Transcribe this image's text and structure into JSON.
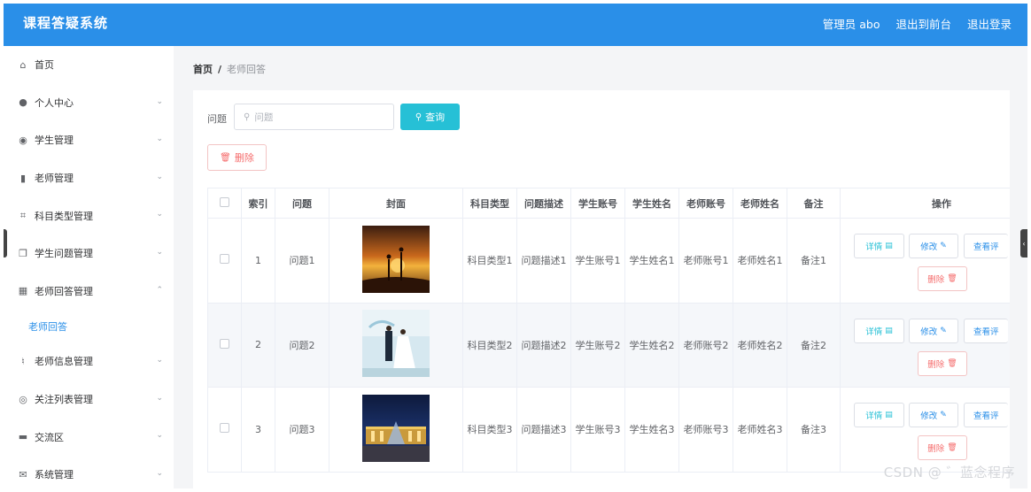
{
  "header": {
    "title": "课程答疑系统",
    "admin": "管理员 abo",
    "back_to_front": "退出到前台",
    "logout": "退出登录",
    "color": "#2a8fe8"
  },
  "sidebar": {
    "items": [
      {
        "label": "首页",
        "icon": "home-icon",
        "glyph": "⌂"
      },
      {
        "label": "个人中心",
        "icon": "user-icon",
        "glyph": "●"
      },
      {
        "label": "学生管理",
        "icon": "location-icon",
        "glyph": "◉"
      },
      {
        "label": "老师管理",
        "icon": "chart-bars-icon",
        "glyph": "▮"
      },
      {
        "label": "科目类型管理",
        "icon": "crop-icon",
        "glyph": "⌗"
      },
      {
        "label": "学生问题管理",
        "icon": "copy-icon",
        "glyph": "❐"
      },
      {
        "label": "老师回答管理",
        "icon": "grid-icon",
        "glyph": "▦"
      },
      {
        "label": "老师信息管理",
        "icon": "microphone-icon",
        "glyph": "♮"
      },
      {
        "label": "关注列表管理",
        "icon": "disc-icon",
        "glyph": "◎"
      },
      {
        "label": "交流区",
        "icon": "briefcase-icon",
        "glyph": "▬"
      },
      {
        "label": "系统管理",
        "icon": "mail-icon",
        "glyph": "✉"
      }
    ],
    "sub_item": "老师回答"
  },
  "breadcrumb": {
    "home": "首页",
    "sep": "/",
    "current": "老师回答"
  },
  "search": {
    "label": "问题",
    "placeholder": "问题",
    "query_button": "查询",
    "delete_button": "删除"
  },
  "table": {
    "headers": [
      "",
      "索引",
      "问题",
      "封面",
      "科目类型",
      "问题描述",
      "学生账号",
      "学生姓名",
      "老师账号",
      "老师姓名",
      "备注",
      "操作"
    ],
    "rows": [
      {
        "index": "1",
        "question": "问题1",
        "cover": "sunset-couple-photo",
        "subject": "科目类型1",
        "desc": "问题描述1",
        "student_acc": "学生账号1",
        "student_name": "学生姓名1",
        "teacher_acc": "老师账号1",
        "teacher_name": "老师姓名1",
        "note": "备注1"
      },
      {
        "index": "2",
        "question": "问题2",
        "cover": "wedding-couple-photo",
        "subject": "科目类型2",
        "desc": "问题描述2",
        "student_acc": "学生账号2",
        "student_name": "学生姓名2",
        "teacher_acc": "老师账号2",
        "teacher_name": "老师姓名2",
        "note": "备注2"
      },
      {
        "index": "3",
        "question": "问题3",
        "cover": "night-palace-photo",
        "subject": "科目类型3",
        "desc": "问题描述3",
        "student_acc": "学生账号3",
        "student_name": "学生姓名3",
        "teacher_acc": "老师账号3",
        "teacher_name": "老师姓名3",
        "note": "备注3"
      }
    ],
    "actions": {
      "detail": "详情",
      "edit": "修改",
      "view": "查看评",
      "delete": "删除"
    }
  },
  "watermark": "CSDN @ ゛蓝念程序",
  "colors": {
    "accent": "#2a8fe8",
    "query": "#26c0d6",
    "danger": "#f56c6c"
  }
}
